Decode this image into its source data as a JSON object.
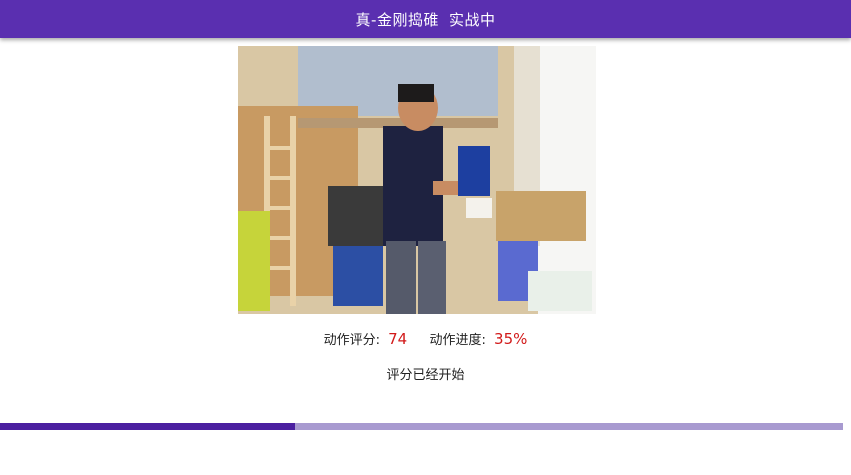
{
  "header": {
    "title": "真-金刚捣碓",
    "status": "实战中",
    "background_color": "#5a2fb0"
  },
  "video": {
    "description_icon": "camera-feed"
  },
  "score": {
    "label": "动作评分:",
    "value": "74",
    "progress_label": "动作进度:",
    "progress_value": "35%",
    "value_color": "#d21a1a"
  },
  "status_text": "评分已经开始",
  "progress_bar": {
    "fraction": 0.35,
    "fill_color": "#4b1fa0",
    "track_color": "#a89ad0"
  }
}
